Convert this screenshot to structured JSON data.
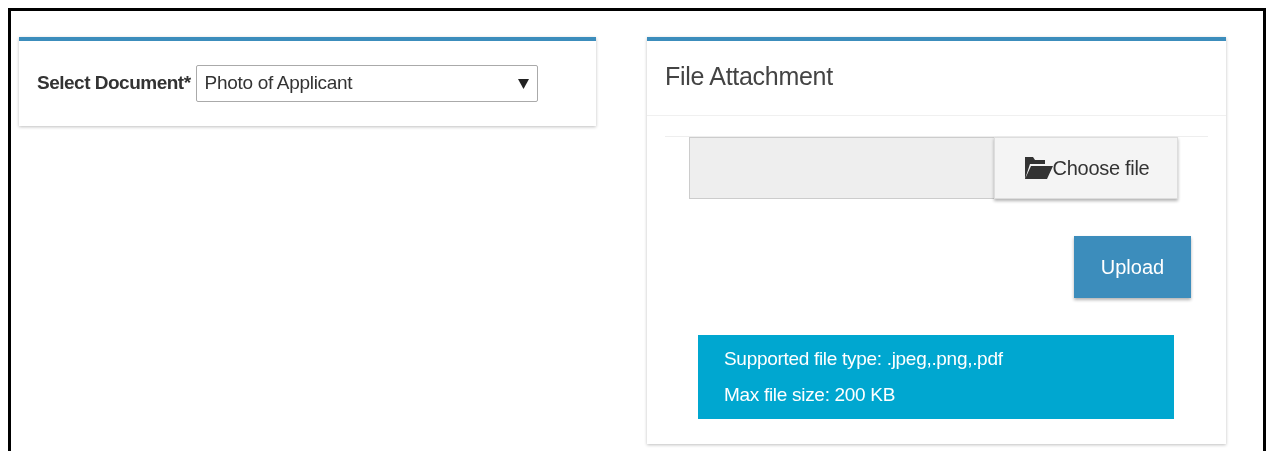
{
  "document_panel": {
    "label": "Select Document*",
    "select_value": "Photo of Applicant"
  },
  "attachment_panel": {
    "title": "File Attachment",
    "choose_button": "Choose file",
    "upload_button": "Upload",
    "info_lines": [
      "Supported file type: .jpeg,.png,.pdf",
      "Max file size: 200 KB"
    ]
  }
}
